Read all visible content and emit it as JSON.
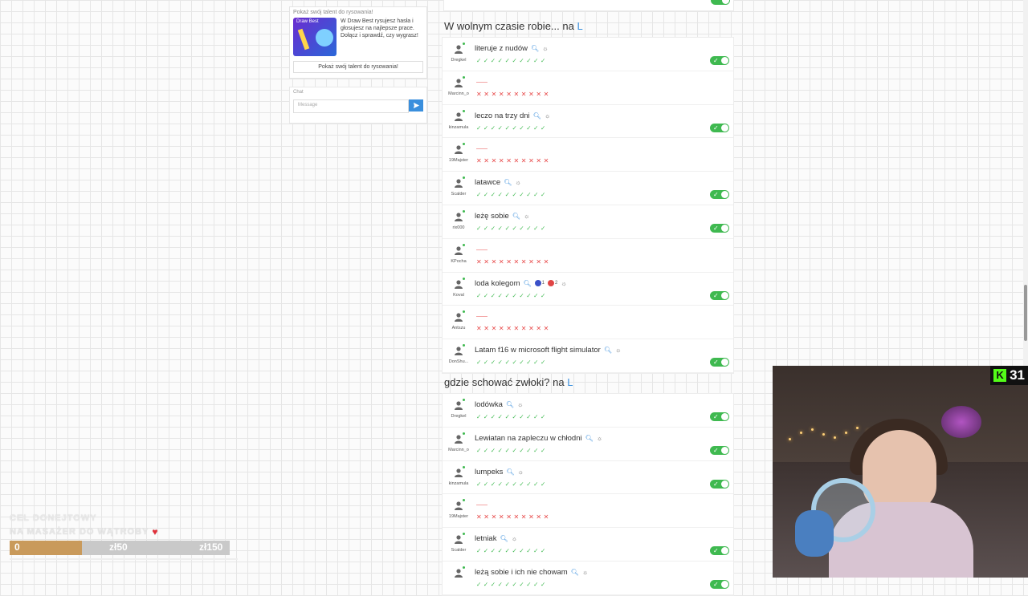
{
  "promo": {
    "title": "Pokaż swój talent do rysowania!",
    "image_label": "Draw Best",
    "text": "W Draw Best rysujesz hasła i głosujesz na najlepsze prace. Dołącz i sprawdź, czy wygrasz!",
    "button": "Pokaż swój talent do rysowania!"
  },
  "chat": {
    "title": "Chat",
    "placeholder": "Message",
    "send_icon": "send-icon"
  },
  "sections": [
    {
      "title": "W wolnym czasie robie... na",
      "letter": "L",
      "rows": [
        {
          "player": "Dregkel",
          "answer": "literuje z nudów",
          "ok": true
        },
        {
          "player": "Marcinn_o",
          "answer": "",
          "ok": false
        },
        {
          "player": "kinzamula",
          "answer": "leczo na trzy dni",
          "ok": true
        },
        {
          "player": "19Majster",
          "answer": "",
          "ok": false
        },
        {
          "player": "Scalder",
          "answer": "latawce",
          "ok": true
        },
        {
          "player": "rix000",
          "answer": "leżę sobie",
          "ok": true
        },
        {
          "player": "KPocha",
          "answer": "",
          "ok": false
        },
        {
          "player": "Koval",
          "answer": "loda kolegom",
          "ok": true,
          "votes_blue": "1",
          "votes_red": "2"
        },
        {
          "player": "Antszu",
          "answer": "",
          "ok": false
        },
        {
          "player": "DonShu...",
          "answer": "Latam f16 w microsoft flight simulator",
          "ok": true
        }
      ]
    },
    {
      "title": "gdzie schować zwłoki? na",
      "letter": "L",
      "rows": [
        {
          "player": "Dregkel",
          "answer": "lodówka",
          "ok": true
        },
        {
          "player": "Marcinn_o",
          "answer": "Lewiatan na zapleczu w chłodni",
          "ok": true
        },
        {
          "player": "kinzamula",
          "answer": "lumpeks",
          "ok": true
        },
        {
          "player": "19Majster",
          "answer": "",
          "ok": false
        },
        {
          "player": "Scalder",
          "answer": "letniak",
          "ok": true
        },
        {
          "player": "",
          "answer": "leżą sobie i ich nie chowam",
          "ok": true
        }
      ]
    }
  ],
  "marks": {
    "ok": "✓",
    "bad": "✕",
    "count": 10
  },
  "goal": {
    "title": "CEL DONEJTOWY",
    "subtitle": "NA MASAŻER DO WĄTROBY",
    "current": "0",
    "mid": "zł50",
    "target": "zł150",
    "progress": 0.33
  },
  "cam": {
    "viewers": "31"
  },
  "colors": {
    "ok": "#3fb950",
    "bad": "#e84c4c",
    "accent": "#3a8fdd",
    "goal_fill": "#c99a5b"
  }
}
